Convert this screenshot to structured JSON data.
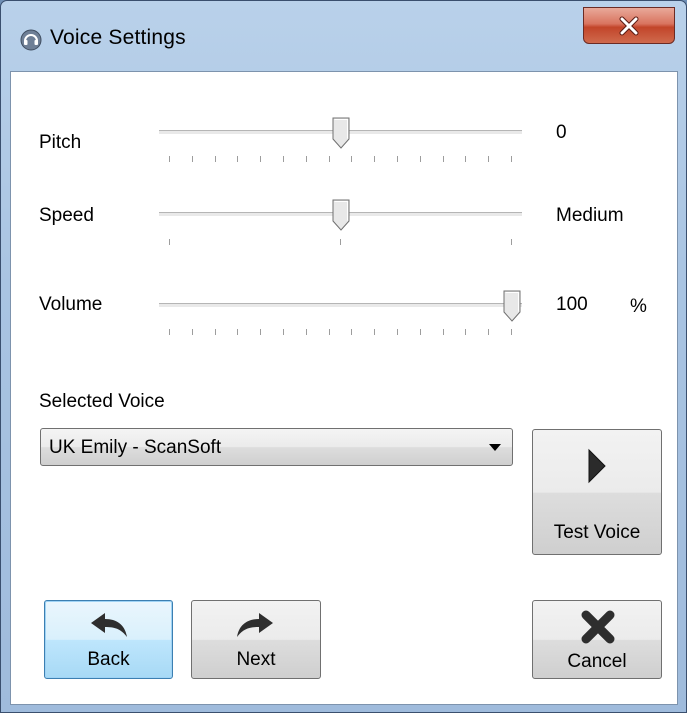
{
  "window": {
    "title": "Voice Settings"
  },
  "icons": {
    "app": "headset-icon",
    "close": "close-icon",
    "play": "play-icon",
    "back": "back-arrow-icon",
    "next": "next-arrow-icon",
    "cancel": "cancel-x-icon"
  },
  "pitch": {
    "label": "Pitch",
    "value": "0",
    "level": 0.5
  },
  "speed": {
    "label": "Speed",
    "value": "Medium",
    "level": 0.5
  },
  "volume": {
    "label": "Volume",
    "value": "100",
    "unit": "%",
    "level": 1.0
  },
  "voice": {
    "label": "Selected Voice",
    "selected": "UK Emily - ScanSoft"
  },
  "buttons": {
    "test_voice": "Test Voice",
    "back": "Back",
    "next": "Next",
    "cancel": "Cancel"
  },
  "colors": {
    "focus_border": "#3c7fb1",
    "close_red": "#c2452a"
  }
}
